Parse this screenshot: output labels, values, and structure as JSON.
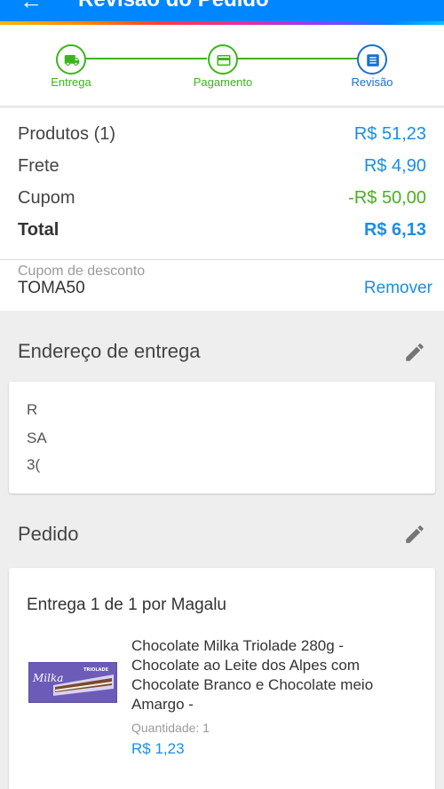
{
  "appbar": {
    "title": "Revisão do Pedido",
    "back_icon": "arrow-back-icon"
  },
  "steps": [
    {
      "label": "Entrega",
      "icon": "truck-icon"
    },
    {
      "label": "Pagamento",
      "icon": "card-icon"
    },
    {
      "label": "Revisão",
      "icon": "list-icon"
    }
  ],
  "summary": {
    "products_label": "Produtos (1)",
    "products_value": "R$ 51,23",
    "shipping_label": "Frete",
    "shipping_value": "R$ 4,90",
    "coupon_label": "Cupom",
    "coupon_value": "-R$ 50,00",
    "total_label": "Total",
    "total_value": "R$ 6,13"
  },
  "coupon": {
    "label": "Cupom de desconto",
    "code": "TOMA50",
    "remove_label": "Remover"
  },
  "address": {
    "title": "Endereço de entrega",
    "lines": [
      "R",
      "SA",
      "3("
    ]
  },
  "order": {
    "title": "Pedido",
    "delivery_title": "Entrega 1 de 1 por Magalu",
    "product": {
      "name": "Chocolate Milka Triolade 280g - Chocolate ao Leite dos Alpes com Chocolate Branco e Chocolate meio Amargo -",
      "quantity": "Quantidade:  1",
      "price": "R$ 1,23",
      "brand": "Milka",
      "variant": "TRIOLADE"
    }
  },
  "colors": {
    "primary_blue": "#0086ff",
    "link_blue": "#1a8ee6",
    "step_green": "#3cb51d",
    "discount_green": "#4caf1f",
    "step_active_blue": "#1a6fd0",
    "milka_purple": "#6d5bb8"
  }
}
